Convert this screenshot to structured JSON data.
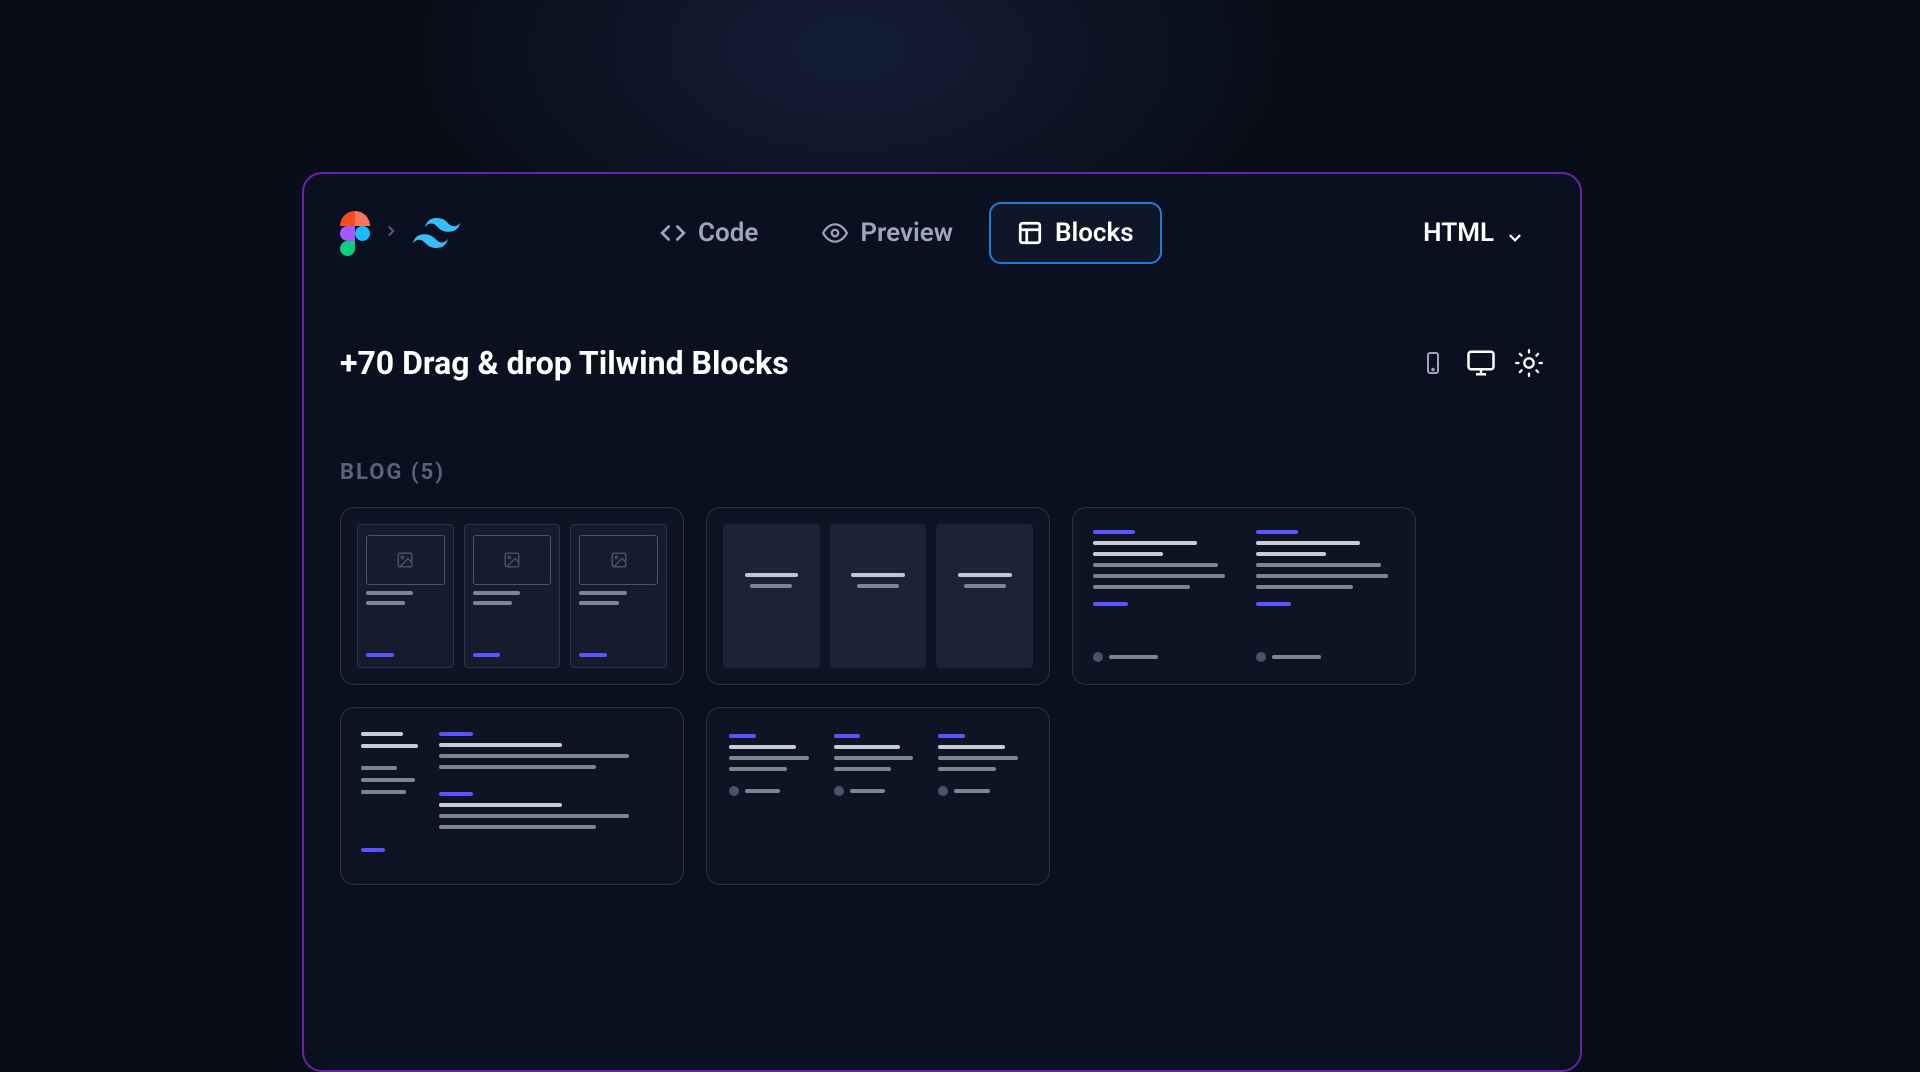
{
  "tabs": {
    "code": "Code",
    "preview": "Preview",
    "blocks": "Blocks",
    "active": "blocks"
  },
  "format_dropdown": {
    "selected": "HTML"
  },
  "page": {
    "title": "+70 Drag & drop Tilwind Blocks"
  },
  "section": {
    "label": "BLOG (5)"
  }
}
